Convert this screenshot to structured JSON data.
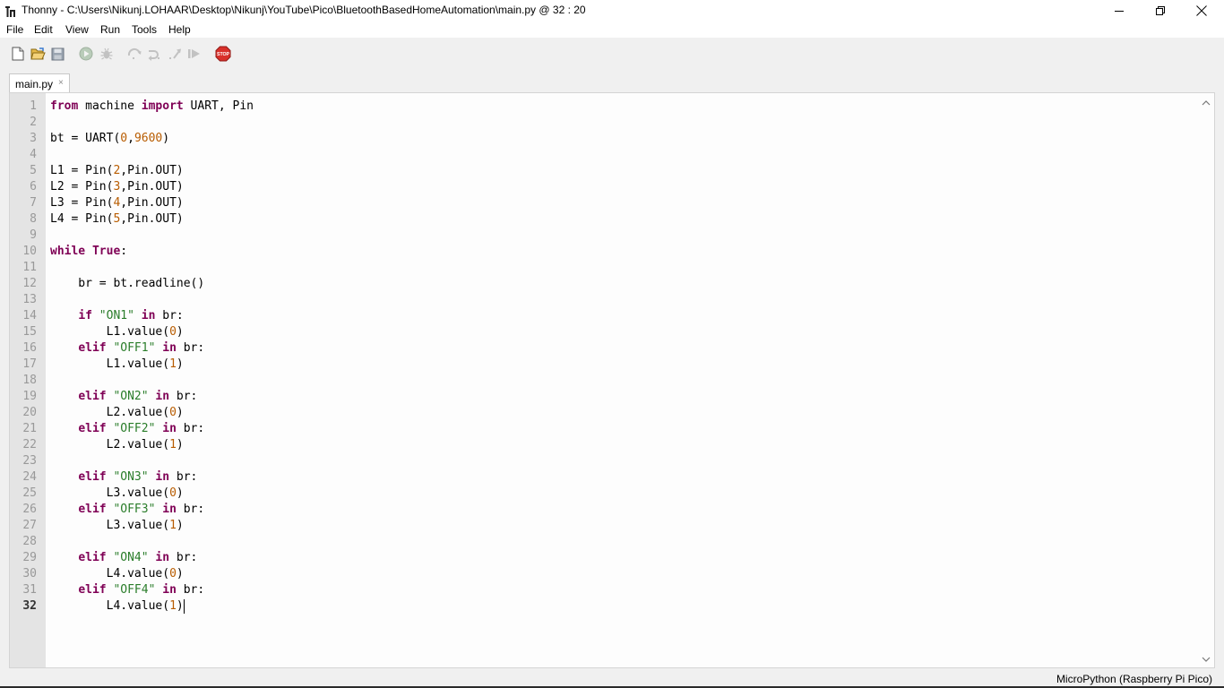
{
  "window": {
    "title": "Thonny  -  C:\\Users\\Nikunj.LOHAAR\\Desktop\\Nikunj\\YouTube\\Pico\\BluetoothBasedHomeAutomation\\main.py  @  32 : 20"
  },
  "menu": {
    "items": [
      {
        "label": "File"
      },
      {
        "label": "Edit"
      },
      {
        "label": "View"
      },
      {
        "label": "Run"
      },
      {
        "label": "Tools"
      },
      {
        "label": "Help"
      }
    ]
  },
  "toolbar": {
    "stop_label": "STOP"
  },
  "tab": {
    "label": "main.py",
    "close": "×"
  },
  "editor": {
    "lines": [
      {
        "n": "1",
        "segments": [
          {
            "t": "from",
            "c": "kw"
          },
          {
            "t": " machine ",
            "c": ""
          },
          {
            "t": "import",
            "c": "kw"
          },
          {
            "t": " UART, Pin",
            "c": ""
          }
        ]
      },
      {
        "n": "2",
        "segments": []
      },
      {
        "n": "3",
        "segments": [
          {
            "t": "bt = UART(",
            "c": ""
          },
          {
            "t": "0",
            "c": "num"
          },
          {
            "t": ",",
            "c": ""
          },
          {
            "t": "9600",
            "c": "num"
          },
          {
            "t": ")",
            "c": ""
          }
        ]
      },
      {
        "n": "4",
        "segments": []
      },
      {
        "n": "5",
        "segments": [
          {
            "t": "L1 = Pin(",
            "c": ""
          },
          {
            "t": "2",
            "c": "num"
          },
          {
            "t": ",Pin.OUT)",
            "c": ""
          }
        ]
      },
      {
        "n": "6",
        "segments": [
          {
            "t": "L2 = Pin(",
            "c": ""
          },
          {
            "t": "3",
            "c": "num"
          },
          {
            "t": ",Pin.OUT)",
            "c": ""
          }
        ]
      },
      {
        "n": "7",
        "segments": [
          {
            "t": "L3 = Pin(",
            "c": ""
          },
          {
            "t": "4",
            "c": "num"
          },
          {
            "t": ",Pin.OUT)",
            "c": ""
          }
        ]
      },
      {
        "n": "8",
        "segments": [
          {
            "t": "L4 = Pin(",
            "c": ""
          },
          {
            "t": "5",
            "c": "num"
          },
          {
            "t": ",Pin.OUT)",
            "c": ""
          }
        ]
      },
      {
        "n": "9",
        "segments": []
      },
      {
        "n": "10",
        "segments": [
          {
            "t": "while",
            "c": "kw"
          },
          {
            "t": " ",
            "c": ""
          },
          {
            "t": "True",
            "c": "kw"
          },
          {
            "t": ":",
            "c": ""
          }
        ]
      },
      {
        "n": "11",
        "segments": []
      },
      {
        "n": "12",
        "segments": [
          {
            "t": "    br = bt.readline()",
            "c": ""
          }
        ]
      },
      {
        "n": "13",
        "segments": []
      },
      {
        "n": "14",
        "segments": [
          {
            "t": "    ",
            "c": ""
          },
          {
            "t": "if",
            "c": "kw"
          },
          {
            "t": " ",
            "c": ""
          },
          {
            "t": "\"ON1\"",
            "c": "str"
          },
          {
            "t": " ",
            "c": ""
          },
          {
            "t": "in",
            "c": "kw"
          },
          {
            "t": " br:",
            "c": ""
          }
        ]
      },
      {
        "n": "15",
        "segments": [
          {
            "t": "        L1.value(",
            "c": ""
          },
          {
            "t": "0",
            "c": "num"
          },
          {
            "t": ")",
            "c": ""
          }
        ]
      },
      {
        "n": "16",
        "segments": [
          {
            "t": "    ",
            "c": ""
          },
          {
            "t": "elif",
            "c": "kw"
          },
          {
            "t": " ",
            "c": ""
          },
          {
            "t": "\"OFF1\"",
            "c": "str"
          },
          {
            "t": " ",
            "c": ""
          },
          {
            "t": "in",
            "c": "kw"
          },
          {
            "t": " br:",
            "c": ""
          }
        ]
      },
      {
        "n": "17",
        "segments": [
          {
            "t": "        L1.value(",
            "c": ""
          },
          {
            "t": "1",
            "c": "num"
          },
          {
            "t": ")",
            "c": ""
          }
        ]
      },
      {
        "n": "18",
        "segments": []
      },
      {
        "n": "19",
        "segments": [
          {
            "t": "    ",
            "c": ""
          },
          {
            "t": "elif",
            "c": "kw"
          },
          {
            "t": " ",
            "c": ""
          },
          {
            "t": "\"ON2\"",
            "c": "str"
          },
          {
            "t": " ",
            "c": ""
          },
          {
            "t": "in",
            "c": "kw"
          },
          {
            "t": " br:",
            "c": ""
          }
        ]
      },
      {
        "n": "20",
        "segments": [
          {
            "t": "        L2.value(",
            "c": ""
          },
          {
            "t": "0",
            "c": "num"
          },
          {
            "t": ")",
            "c": ""
          }
        ]
      },
      {
        "n": "21",
        "segments": [
          {
            "t": "    ",
            "c": ""
          },
          {
            "t": "elif",
            "c": "kw"
          },
          {
            "t": " ",
            "c": ""
          },
          {
            "t": "\"OFF2\"",
            "c": "str"
          },
          {
            "t": " ",
            "c": ""
          },
          {
            "t": "in",
            "c": "kw"
          },
          {
            "t": " br:",
            "c": ""
          }
        ]
      },
      {
        "n": "22",
        "segments": [
          {
            "t": "        L2.value(",
            "c": ""
          },
          {
            "t": "1",
            "c": "num"
          },
          {
            "t": ")",
            "c": ""
          }
        ]
      },
      {
        "n": "23",
        "segments": []
      },
      {
        "n": "24",
        "segments": [
          {
            "t": "    ",
            "c": ""
          },
          {
            "t": "elif",
            "c": "kw"
          },
          {
            "t": " ",
            "c": ""
          },
          {
            "t": "\"ON3\"",
            "c": "str"
          },
          {
            "t": " ",
            "c": ""
          },
          {
            "t": "in",
            "c": "kw"
          },
          {
            "t": " br:",
            "c": ""
          }
        ]
      },
      {
        "n": "25",
        "segments": [
          {
            "t": "        L3.value(",
            "c": ""
          },
          {
            "t": "0",
            "c": "num"
          },
          {
            "t": ")",
            "c": ""
          }
        ]
      },
      {
        "n": "26",
        "segments": [
          {
            "t": "    ",
            "c": ""
          },
          {
            "t": "elif",
            "c": "kw"
          },
          {
            "t": " ",
            "c": ""
          },
          {
            "t": "\"OFF3\"",
            "c": "str"
          },
          {
            "t": " ",
            "c": ""
          },
          {
            "t": "in",
            "c": "kw"
          },
          {
            "t": " br:",
            "c": ""
          }
        ]
      },
      {
        "n": "27",
        "segments": [
          {
            "t": "        L3.value(",
            "c": ""
          },
          {
            "t": "1",
            "c": "num"
          },
          {
            "t": ")",
            "c": ""
          }
        ]
      },
      {
        "n": "28",
        "segments": []
      },
      {
        "n": "29",
        "segments": [
          {
            "t": "    ",
            "c": ""
          },
          {
            "t": "elif",
            "c": "kw"
          },
          {
            "t": " ",
            "c": ""
          },
          {
            "t": "\"ON4\"",
            "c": "str"
          },
          {
            "t": " ",
            "c": ""
          },
          {
            "t": "in",
            "c": "kw"
          },
          {
            "t": " br:",
            "c": ""
          }
        ]
      },
      {
        "n": "30",
        "segments": [
          {
            "t": "        L4.value(",
            "c": ""
          },
          {
            "t": "0",
            "c": "num"
          },
          {
            "t": ")",
            "c": ""
          }
        ]
      },
      {
        "n": "31",
        "segments": [
          {
            "t": "    ",
            "c": ""
          },
          {
            "t": "elif",
            "c": "kw"
          },
          {
            "t": " ",
            "c": ""
          },
          {
            "t": "\"OFF4\"",
            "c": "str"
          },
          {
            "t": " ",
            "c": ""
          },
          {
            "t": "in",
            "c": "kw"
          },
          {
            "t": " br:",
            "c": ""
          }
        ]
      },
      {
        "n": "32",
        "segments": [
          {
            "t": "        L4.value(",
            "c": ""
          },
          {
            "t": "1",
            "c": "num"
          },
          {
            "t": ")",
            "c": ""
          }
        ]
      }
    ],
    "current_line": "32"
  },
  "status": {
    "interpreter": "MicroPython (Raspberry Pi Pico)"
  },
  "colors": {
    "keyword": "#7f0055",
    "string": "#2a7d2a",
    "number": "#b85c00",
    "gutter": "#e4e4e4",
    "stop": "#d9302a"
  },
  "icons": [
    "thonny-icon",
    "new-file-icon",
    "open-file-icon",
    "save-icon",
    "run-icon",
    "debug-icon",
    "step-over-icon",
    "step-into-icon",
    "step-out-icon",
    "resume-icon",
    "stop-icon",
    "minimize-icon",
    "maximize-icon",
    "close-icon",
    "scroll-up-icon",
    "scroll-down-icon"
  ]
}
